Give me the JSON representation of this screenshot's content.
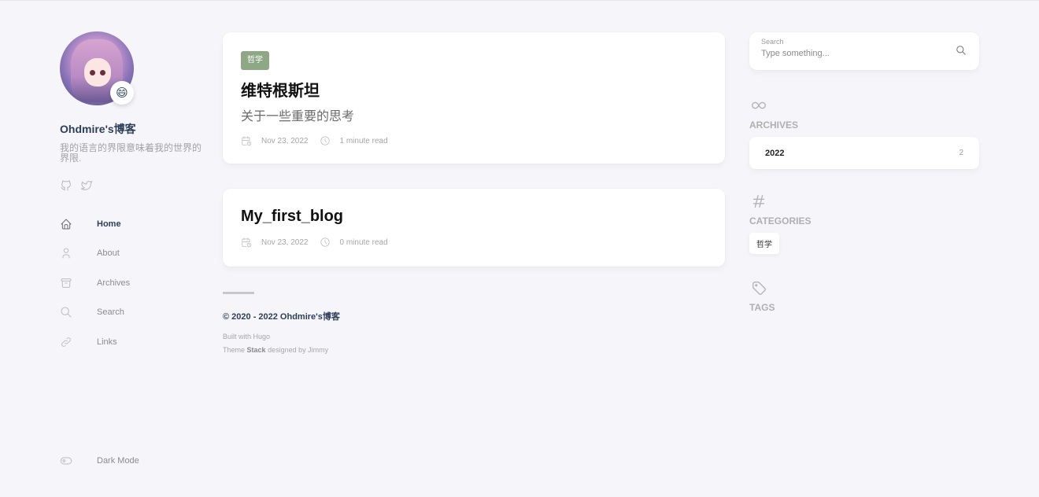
{
  "profile": {
    "site_name": "Ohdmire's博客",
    "description": "我的语言的界限意味着我的世界的界限.",
    "emoji": "😄"
  },
  "social": [
    {
      "icon": "github-icon"
    },
    {
      "icon": "twitter-icon"
    }
  ],
  "menu": [
    {
      "label": "Home",
      "icon": "home-icon",
      "active": true
    },
    {
      "label": "About",
      "icon": "user-icon",
      "active": false
    },
    {
      "label": "Archives",
      "icon": "archive-icon",
      "active": false
    },
    {
      "label": "Search",
      "icon": "search-icon",
      "active": false
    },
    {
      "label": "Links",
      "icon": "link-icon",
      "active": false
    }
  ],
  "dark_mode": {
    "label": "Dark Mode",
    "icon": "toggle-icon"
  },
  "posts": [
    {
      "category": "哲学",
      "title": "维特根斯坦",
      "subtitle": "关于一些重要的思考",
      "date": "Nov 23, 2022",
      "read_time": "1 minute read"
    },
    {
      "title": "My_first_blog",
      "date": "Nov 23, 2022",
      "read_time": "0 minute read"
    }
  ],
  "footer": {
    "copyright": "© 2020 - 2022 Ohdmire's博客",
    "built_with": "Built with Hugo",
    "theme_prefix": "Theme",
    "theme_name": "Stack",
    "theme_suffix": "designed by Jimmy"
  },
  "search": {
    "label": "Search",
    "placeholder": "Type something..."
  },
  "archives": {
    "title": "ARCHIVES",
    "icon": "infinity-icon",
    "items": [
      {
        "year": "2022",
        "count": "2"
      }
    ]
  },
  "categories": {
    "title": "CATEGORIES",
    "icon": "hash-icon",
    "items": [
      "哲学"
    ]
  },
  "tags": {
    "title": "TAGS",
    "icon": "tag-icon"
  },
  "colors": {
    "background": "#f5f5fa",
    "card": "#ffffff",
    "category_chip": "#8ea885",
    "heading": "#2d3f57"
  }
}
